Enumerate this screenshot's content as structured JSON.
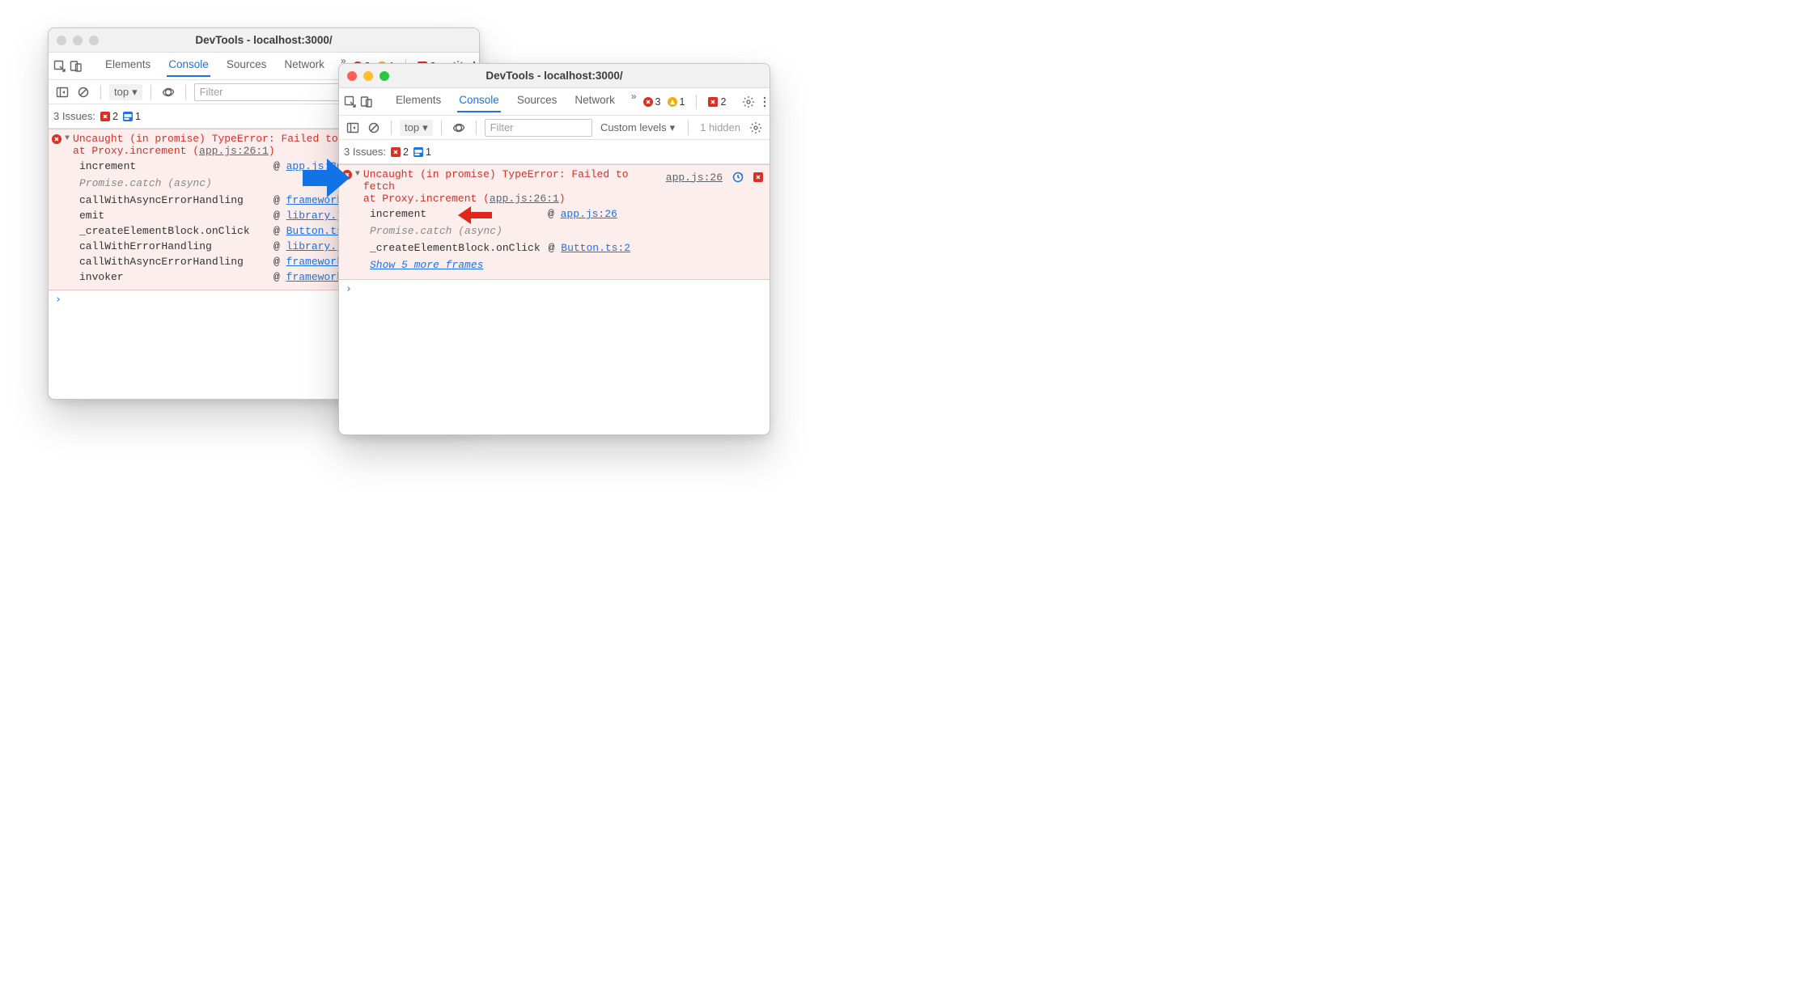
{
  "left": {
    "title": "DevTools - localhost:3000/",
    "tabs": [
      "Elements",
      "Console",
      "Sources",
      "Network"
    ],
    "active_tab": "Console",
    "counts": {
      "err_circle": "3",
      "warn": "1",
      "err_sq": "2"
    },
    "sub": {
      "context": "top",
      "filter_placeholder": "Filter"
    },
    "issues": {
      "label": "3 Issues:",
      "err": "2",
      "msg": "1"
    },
    "error": {
      "msg_l1": "Uncaught (in promise) TypeError: Failed to fetch",
      "msg_l2_pre": "   at Proxy.increment (",
      "msg_l2_link": "app.js:26:1",
      "msg_l2_post": ")",
      "frames": [
        {
          "fn": "increment",
          "src": "app.js:26"
        },
        {
          "async": "Promise.catch (async)"
        },
        {
          "fn": "callWithAsyncErrorHandling",
          "src": "framework.js:1590"
        },
        {
          "fn": "emit",
          "src": "library.js:2049"
        },
        {
          "fn": "_createElementBlock.onClick",
          "src": "Button.ts:2"
        },
        {
          "fn": "callWithErrorHandling",
          "src": "library.js:1580"
        },
        {
          "fn": "callWithAsyncErrorHandling",
          "src": "framework.js:1588"
        },
        {
          "fn": "invoker",
          "src": "framework.js:8198"
        }
      ]
    }
  },
  "right": {
    "title": "DevTools - localhost:3000/",
    "tabs": [
      "Elements",
      "Console",
      "Sources",
      "Network"
    ],
    "active_tab": "Console",
    "counts": {
      "err_circle": "3",
      "warn": "1",
      "err_sq": "2"
    },
    "sub": {
      "context": "top",
      "filter_placeholder": "Filter",
      "levels": "Custom levels",
      "hidden": "1 hidden"
    },
    "issues": {
      "label": "3 Issues:",
      "err": "2",
      "msg": "1"
    },
    "error": {
      "msg_l1": "Uncaught (in promise) TypeError: Failed to fetch",
      "msg_l2_pre": "   at Proxy.increment (",
      "msg_l2_link": "app.js:26:1",
      "msg_l2_post": ")",
      "toplink": "app.js:26",
      "frames": [
        {
          "fn": "increment",
          "src": "app.js:26"
        },
        {
          "async": "Promise.catch (async)"
        },
        {
          "fn": "_createElementBlock.onClick",
          "src": "Button.ts:2"
        }
      ],
      "show_more": "Show 5 more frames"
    }
  },
  "at_sym": "@"
}
